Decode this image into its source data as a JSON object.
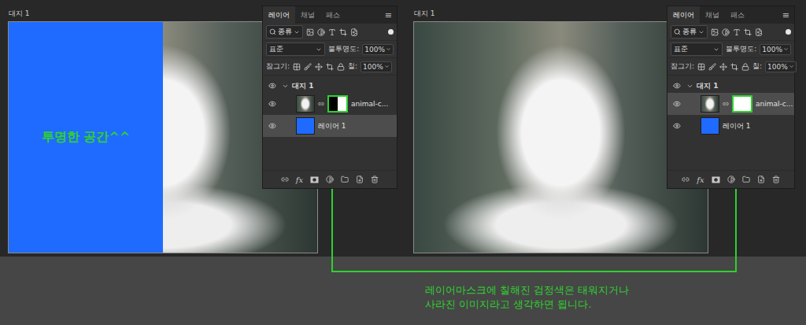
{
  "artboards": [
    {
      "title": "대지 1",
      "canvas_text": "투명한 공간^^",
      "layers_panel": {
        "tabs": [
          {
            "label": "레이어",
            "selected": true
          },
          {
            "label": "채널",
            "selected": false
          },
          {
            "label": "패스",
            "selected": false
          }
        ],
        "menu": "≡",
        "filter": "종류",
        "blend_mode": "표준",
        "opacity_label": "불투명도:",
        "opacity": "100%",
        "lock_label": "잠그기:",
        "fill_label": "칠:",
        "fill": "100%",
        "group": {
          "name": "대지 1",
          "expanded": true
        },
        "layers": [
          {
            "name": "animal-c...",
            "kind": "photo",
            "visible": true,
            "selected": false,
            "mask_black": 0.5
          },
          {
            "name": "레이어 1",
            "kind": "fill",
            "visible": true,
            "selected": true,
            "color": "#1f6bff"
          }
        ],
        "footer_fx": "fx"
      }
    },
    {
      "title": "대지 1",
      "layers_panel": {
        "tabs": [
          {
            "label": "레이어",
            "selected": true
          },
          {
            "label": "채널",
            "selected": false
          },
          {
            "label": "패스",
            "selected": false
          }
        ],
        "menu": "≡",
        "filter": "종류",
        "blend_mode": "표준",
        "opacity_label": "불투명도:",
        "opacity": "100%",
        "lock_label": "잠그기:",
        "fill_label": "칠:",
        "fill": "100%",
        "group": {
          "name": "대지 1",
          "expanded": true
        },
        "layers": [
          {
            "name": "animal-c...",
            "kind": "photo",
            "visible": true,
            "selected": true,
            "mask_black": 0
          },
          {
            "name": "레이어 1",
            "kind": "fill",
            "visible": true,
            "selected": false,
            "color": "#1f6bff"
          }
        ],
        "footer_fx": "fx"
      }
    }
  ],
  "caption": [
    "레이어마스크에 칠해진 검정색은 태워지거나",
    "사라진 이미지라고 생각하면 됩니다."
  ]
}
